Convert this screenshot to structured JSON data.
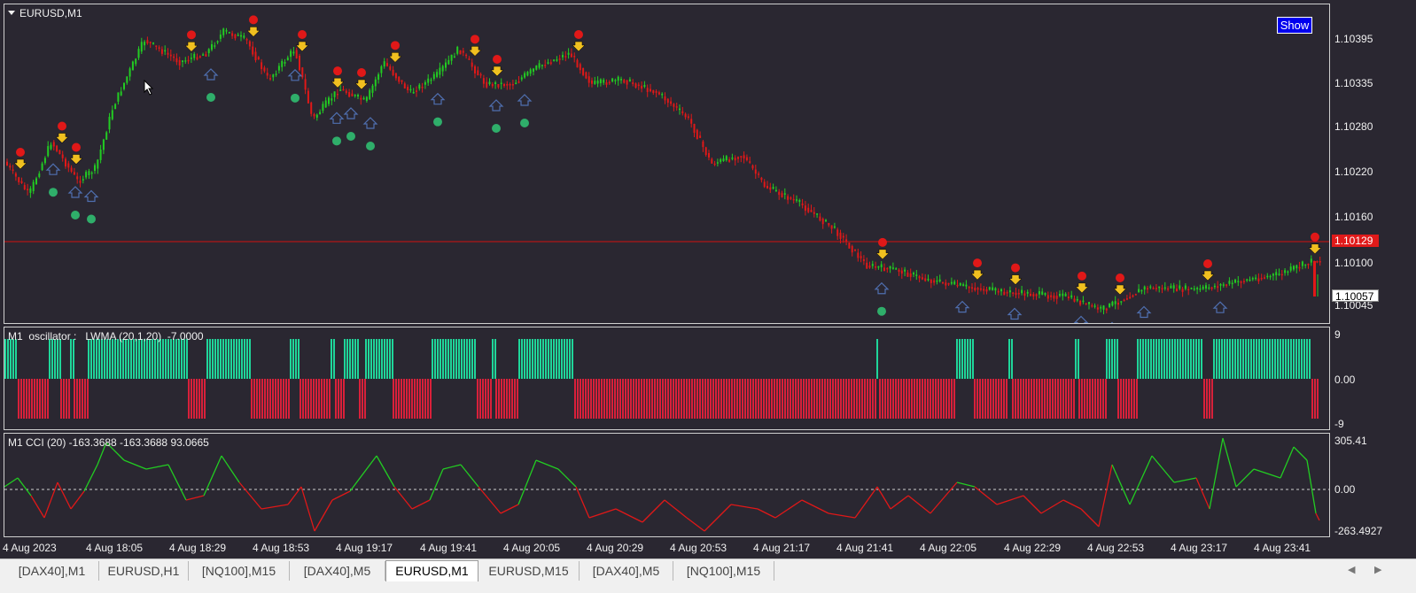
{
  "window": {
    "symbol_label": "EURUSD,M1",
    "show_label": "Show"
  },
  "price_scale": {
    "ticks": [
      "1.10395",
      "1.10335",
      "1.10280",
      "1.10220",
      "1.10160",
      "1.10100",
      "1.10045"
    ],
    "current_price": "1.10129",
    "last_price": "1.10057"
  },
  "oscillator": {
    "label": "M1  oscillator :   LWMA (20,1,20)  -7.0000",
    "ticks": [
      "9",
      "0.00",
      "-9"
    ],
    "colors": {
      "up": "#1fd69a",
      "down": "#d9203a"
    }
  },
  "cci": {
    "label": "M1 CCI (20) -163.3688 -163.3688 93.0665",
    "ticks": [
      "305.41",
      "0.00",
      "-263.4927"
    ],
    "colors": {
      "up": "#22cc22",
      "down": "#e01818"
    }
  },
  "time_axis": [
    "4 Aug 2023",
    "4 Aug 18:05",
    "4 Aug 18:29",
    "4 Aug 18:53",
    "4 Aug 19:17",
    "4 Aug 19:41",
    "4 Aug 20:05",
    "4 Aug 20:29",
    "4 Aug 20:53",
    "4 Aug 21:17",
    "4 Aug 21:41",
    "4 Aug 22:05",
    "4 Aug 22:29",
    "4 Aug 22:53",
    "4 Aug 23:17",
    "4 Aug 23:41"
  ],
  "tabs": [
    "[DAX40],M1",
    "EURUSD,H1",
    "[NQ100],M15",
    "[DAX40],M5",
    "EURUSD,M1",
    "EURUSD,M15",
    "[DAX40],M5",
    "[NQ100],M15"
  ],
  "active_tab": 4,
  "icons": {
    "scroll_left": "triangle-left-icon",
    "scroll_right": "triangle-right-icon"
  },
  "colors": {
    "bull_candle": "#22cc22",
    "bear_candle": "#e01818",
    "price_line": "#d01010",
    "arrow_down": "#f0c020",
    "arrow_up": "#4f6fb0"
  }
}
